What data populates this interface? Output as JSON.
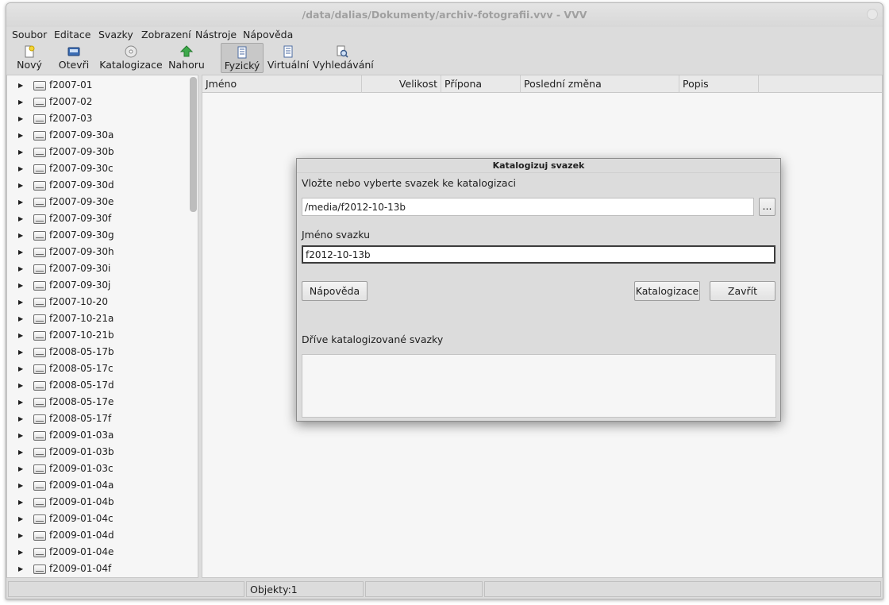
{
  "window": {
    "title": "/data/dalias/Dokumenty/archiv-fotografii.vvv - VVV"
  },
  "menu": [
    "Soubor",
    "Editace",
    "Svazky",
    "Zobrazení",
    "Nástroje",
    "Nápověda"
  ],
  "toolbar": {
    "new": "Nový",
    "open": "Otevři",
    "catalog": "Katalogizace",
    "up": "Nahoru",
    "physical": "Fyzický",
    "virtual": "Virtuální",
    "search": "Vyhledávání"
  },
  "tree": {
    "items": [
      "f2007-01",
      "f2007-02",
      "f2007-03",
      "f2007-09-30a",
      "f2007-09-30b",
      "f2007-09-30c",
      "f2007-09-30d",
      "f2007-09-30e",
      "f2007-09-30f",
      "f2007-09-30g",
      "f2007-09-30h",
      "f2007-09-30i",
      "f2007-09-30j",
      "f2007-10-20",
      "f2007-10-21a",
      "f2007-10-21b",
      "f2008-05-17b",
      "f2008-05-17c",
      "f2008-05-17d",
      "f2008-05-17e",
      "f2008-05-17f",
      "f2009-01-03a",
      "f2009-01-03b",
      "f2009-01-03c",
      "f2009-01-04a",
      "f2009-01-04b",
      "f2009-01-04c",
      "f2009-01-04d",
      "f2009-01-04e",
      "f2009-01-04f"
    ]
  },
  "list": {
    "columns": [
      "Jméno",
      "Velikost",
      "Přípona",
      "Poslední změna",
      "Popis"
    ]
  },
  "status": {
    "objects": "Objekty:1"
  },
  "dialog": {
    "title": "Katalogizuj svazek",
    "path_label": "Vložte nebo vyberte svazek ke katalogizaci",
    "path_value": "/media/f2012-10-13b",
    "browse_label": "...",
    "name_label": "Jméno svazku",
    "name_value": "f2012-10-13b",
    "help_button": "Nápověda",
    "catalog_button": "Katalogizace",
    "close_button": "Zavřít",
    "previous_label": "Dříve katalogizované svazky"
  }
}
